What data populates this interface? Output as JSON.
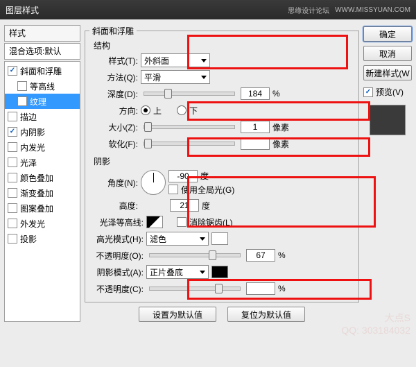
{
  "window": {
    "title": "图层样式"
  },
  "titlebar": {
    "forum": "思缘设计论坛",
    "url": "WWW.MISSYUAN.COM"
  },
  "sidebar": {
    "header": "样式",
    "blend": "混合选项:默认",
    "items": [
      {
        "label": "斜面和浮雕",
        "checked": true,
        "selected": false,
        "indent": false
      },
      {
        "label": "等高线",
        "checked": false,
        "selected": false,
        "indent": true
      },
      {
        "label": "纹理",
        "checked": false,
        "selected": true,
        "indent": true
      },
      {
        "label": "描边",
        "checked": false,
        "selected": false,
        "indent": false
      },
      {
        "label": "内阴影",
        "checked": true,
        "selected": false,
        "indent": false
      },
      {
        "label": "内发光",
        "checked": false,
        "selected": false,
        "indent": false
      },
      {
        "label": "光泽",
        "checked": false,
        "selected": false,
        "indent": false
      },
      {
        "label": "颜色叠加",
        "checked": false,
        "selected": false,
        "indent": false
      },
      {
        "label": "渐变叠加",
        "checked": false,
        "selected": false,
        "indent": false
      },
      {
        "label": "图案叠加",
        "checked": false,
        "selected": false,
        "indent": false
      },
      {
        "label": "外发光",
        "checked": false,
        "selected": false,
        "indent": false
      },
      {
        "label": "投影",
        "checked": false,
        "selected": false,
        "indent": false
      }
    ]
  },
  "main": {
    "groupTitle": "斜面和浮雕",
    "structTitle": "结构",
    "style": {
      "label": "样式(T):",
      "value": "外斜面"
    },
    "technique": {
      "label": "方法(Q):",
      "value": "平滑"
    },
    "depth": {
      "label": "深度(D):",
      "value": "184",
      "unit": "%"
    },
    "direction": {
      "label": "方向:",
      "up": "上",
      "down": "下"
    },
    "size": {
      "label": "大小(Z):",
      "value": "1",
      "unit": "像素"
    },
    "soften": {
      "label": "软化(F):",
      "value": "",
      "unit": "像素"
    },
    "shadingTitle": "阴影",
    "angle": {
      "label": "角度(N):",
      "value": "-90",
      "unit": "度"
    },
    "globalLight": {
      "label": "使用全局光(G)"
    },
    "altitude": {
      "label": "高度:",
      "value": "21",
      "unit": "度"
    },
    "glossContour": {
      "label": "光泽等高线:",
      "antialias": "消除锯齿(L)"
    },
    "highlightMode": {
      "label": "高光模式(H):",
      "value": "滤色"
    },
    "highlightOpacity": {
      "label": "不透明度(O):",
      "value": "67",
      "unit": "%"
    },
    "shadowMode": {
      "label": "阴影模式(A):",
      "value": "正片叠底"
    },
    "shadowOpacity": {
      "label": "不透明度(C):",
      "value": "",
      "unit": "%"
    },
    "defaultsBtn": "设置为默认值",
    "resetBtn": "复位为默认值"
  },
  "right": {
    "ok": "确定",
    "cancel": "取消",
    "newStyle": "新建样式(W",
    "preview": "预览(V)"
  },
  "watermark": {
    "line1": "大点S",
    "line2": "QQ: 303184032"
  }
}
